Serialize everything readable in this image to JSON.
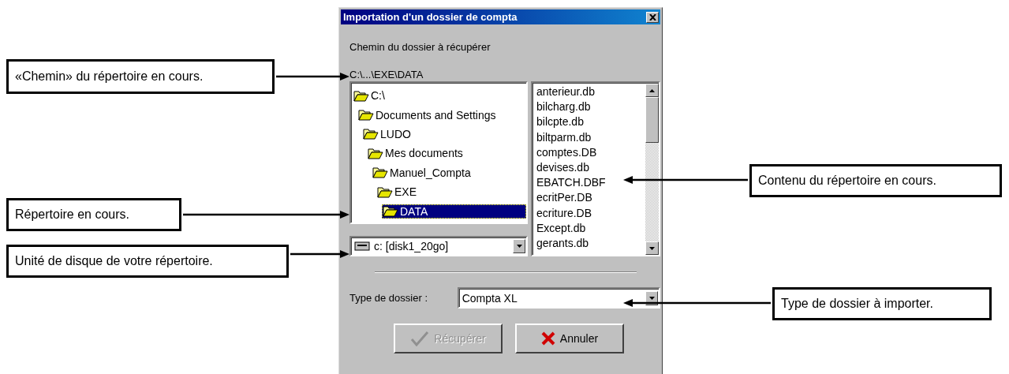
{
  "window": {
    "title": "Importation d'un dossier de compta"
  },
  "path_label": "Chemin du dossier à récupérer",
  "current_path": "C:\\...\\EXE\\DATA",
  "folder_tree": [
    {
      "label": "C:\\",
      "selected": false,
      "children": [
        {
          "label": "Documents and Settings",
          "selected": false,
          "children": [
            {
              "label": "LUDO",
              "selected": false,
              "children": [
                {
                  "label": "Mes documents",
                  "selected": false,
                  "children": [
                    {
                      "label": "Manuel_Compta",
                      "selected": false,
                      "children": [
                        {
                          "label": "EXE",
                          "selected": false,
                          "children": [
                            {
                              "label": "DATA",
                              "selected": true
                            }
                          ]
                        }
                      ]
                    }
                  ]
                }
              ]
            }
          ]
        }
      ]
    }
  ],
  "files": [
    "anterieur.db",
    "bilcharg.db",
    "bilcpte.db",
    "biltparm.db",
    "comptes.DB",
    "devises.db",
    "EBATCH.DBF",
    "ecritPer.DB",
    "ecriture.DB",
    "Except.db",
    "gerants.db"
  ],
  "drive": {
    "value": "c: [disk1_20go]"
  },
  "folder_type": {
    "label": "Type de dossier :",
    "value": "Compta XL"
  },
  "buttons": [
    {
      "label": "Récupérer",
      "kind": "ok",
      "disabled": true
    },
    {
      "label": "Annuler",
      "kind": "cancel",
      "disabled": false
    }
  ],
  "callouts": [
    "«Chemin» du répertoire en cours.",
    "Répertoire en cours.",
    "Unité de disque de votre répertoire.",
    "Contenu du répertoire en cours.",
    "Type de dossier à importer."
  ]
}
